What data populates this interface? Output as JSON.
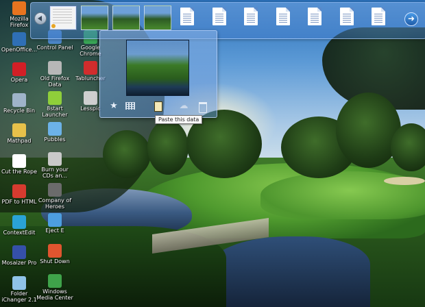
{
  "desktop_icons": [
    {
      "label": "Mozilla Firefox",
      "icon": "firefox-icon",
      "color": "#e8741f"
    },
    {
      "label": "OpenOffice...",
      "icon": "openoffice-icon",
      "color": "#2f6fb5"
    },
    {
      "label": "Opera",
      "icon": "opera-icon",
      "color": "#d21f26"
    },
    {
      "label": "Recycle Bin",
      "icon": "recycle-bin-icon",
      "color": "#9fb4c9"
    },
    {
      "label": "Mathpad",
      "icon": "folder-icon",
      "color": "#e7c14a"
    },
    {
      "label": "Cut the Rope",
      "icon": "cut-the-rope-icon",
      "color": "#ffffff"
    },
    {
      "label": "PDF to HTML",
      "icon": "pdf-to-html-icon",
      "color": "#d63b2f"
    },
    {
      "label": "ContextEdit",
      "icon": "context-edit-icon",
      "color": "#2aa3d6"
    },
    {
      "label": "Mosaizer Pro",
      "icon": "mosaizer-icon",
      "color": "#3550a8"
    },
    {
      "label": "Folder iChanger 2.1",
      "icon": "folder-ichanger-icon",
      "color": "#8fc3e8"
    },
    {
      "label": "Control Panel",
      "icon": "control-panel-icon",
      "color": "#4b86c9"
    },
    {
      "label": "Old Firefox Data",
      "icon": "firefox-data-icon",
      "color": "#b7b7b7"
    },
    {
      "label": "8start Launcher",
      "icon": "launcher-icon",
      "color": "#8fcf3a"
    },
    {
      "label": "Pubbles",
      "icon": "pubbles-icon",
      "color": "#6cb2e8"
    },
    {
      "label": "Burn your CDs an...",
      "icon": "burn-cd-icon",
      "color": "#c9c9c9"
    },
    {
      "label": "Company of Heroes",
      "icon": "company-of-heroes-icon",
      "color": "#6b6b6b"
    },
    {
      "label": "Eject E",
      "icon": "eject-icon",
      "color": "#4d9ee0"
    },
    {
      "label": "Shut Down",
      "icon": "shut-down-icon",
      "color": "#e0552f"
    },
    {
      "label": "Windows Media Center",
      "icon": "windows-media-center-icon",
      "color": "#3fa34a"
    },
    {
      "label": "Google Chrome",
      "icon": "chrome-icon",
      "color": "#3aa657"
    },
    {
      "label": "Tabluncher",
      "icon": "tablauncher-icon",
      "color": "#d12d2d"
    },
    {
      "label": "Lesspic",
      "icon": "lesspic-icon",
      "color": "#cfcfcf"
    }
  ],
  "clipboard_bar": {
    "prev_icon": "chevron-left-icon",
    "next_icon": "arrow-right-icon",
    "clips": [
      {
        "kind": "document-thumbnail",
        "icon": "document-thumbnail-icon"
      },
      {
        "kind": "image-thumbnail",
        "icon": "image-thumbnail-icon"
      },
      {
        "kind": "image-thumbnail",
        "icon": "image-thumbnail-icon"
      },
      {
        "kind": "image-thumbnail",
        "icon": "image-thumbnail-icon"
      },
      {
        "kind": "text-file",
        "icon": "file-icon"
      },
      {
        "kind": "text-file",
        "icon": "file-icon"
      },
      {
        "kind": "text-file",
        "icon": "file-icon"
      },
      {
        "kind": "text-file",
        "icon": "file-icon"
      },
      {
        "kind": "text-file",
        "icon": "file-icon"
      },
      {
        "kind": "text-file",
        "icon": "file-icon"
      },
      {
        "kind": "text-file",
        "icon": "file-icon"
      }
    ]
  },
  "preview": {
    "tools": [
      "star-icon",
      "grid-icon",
      "paste-icon",
      "cloud-icon",
      "trash-icon"
    ],
    "tooltip": "Paste this data"
  },
  "colors": {
    "bar_tint": "#5a8fd8",
    "accent_next": "#1f6fd0"
  }
}
